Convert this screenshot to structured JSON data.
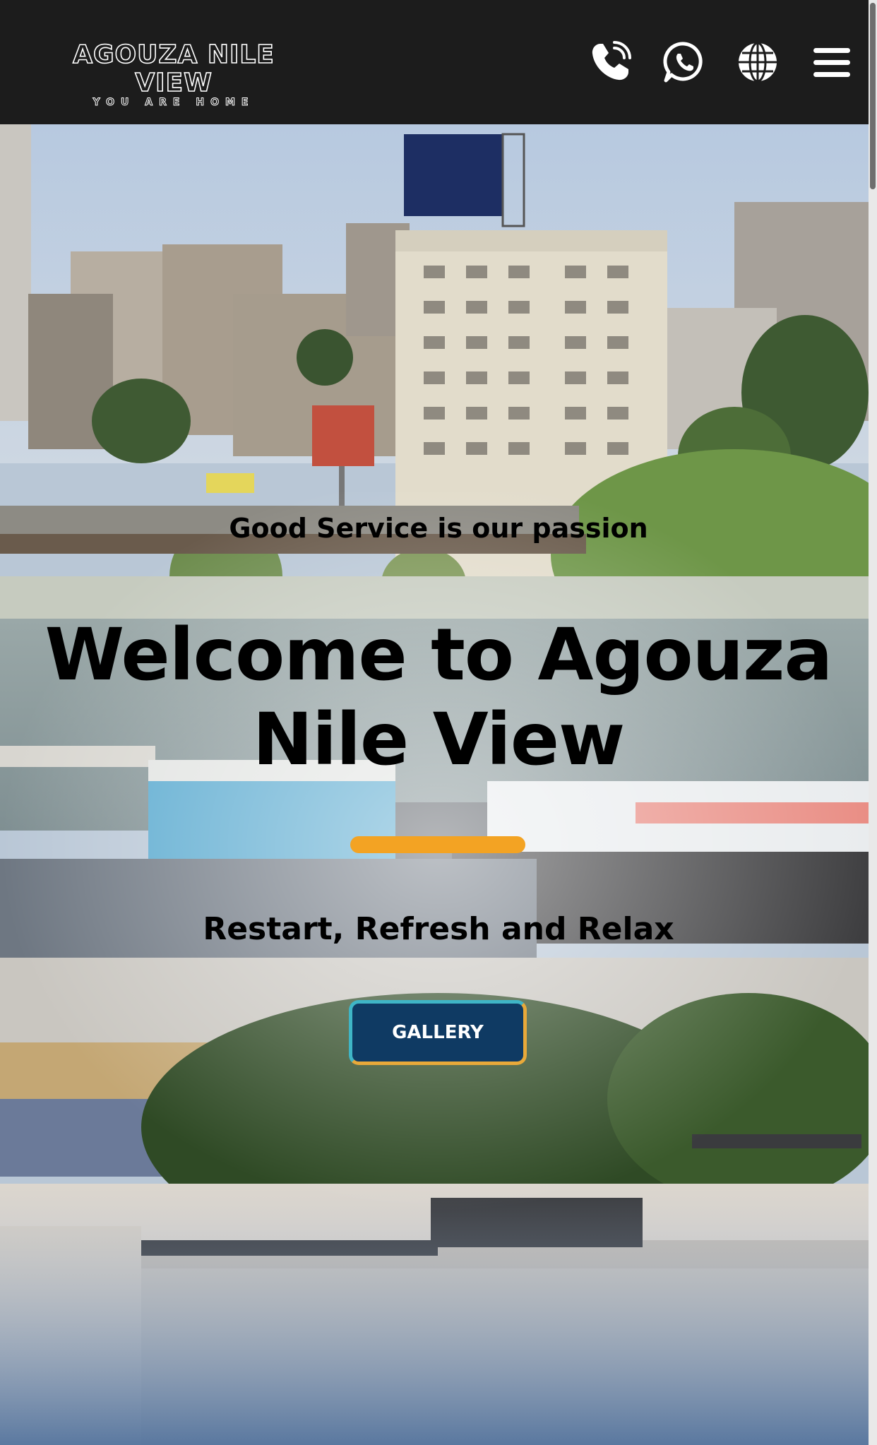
{
  "header": {
    "logo_title": "AGOUZA NILE VIEW",
    "logo_subtitle": "YOU ARE HOME",
    "icons": [
      "phone-icon",
      "whatsapp-icon",
      "globe-icon",
      "menu-icon"
    ]
  },
  "hero": {
    "tagline": "Good Service is our passion",
    "headline": "Welcome to Agouza Nile View",
    "subline": "Restart, Refresh and Relax",
    "button_label": "GALLERY"
  },
  "colors": {
    "header_bg": "#1c1c1c",
    "accent": "#f3a323",
    "button_bg": "#0f3a63",
    "button_border_teal": "#3fb5c6",
    "button_border_gold": "#e8a93a"
  }
}
